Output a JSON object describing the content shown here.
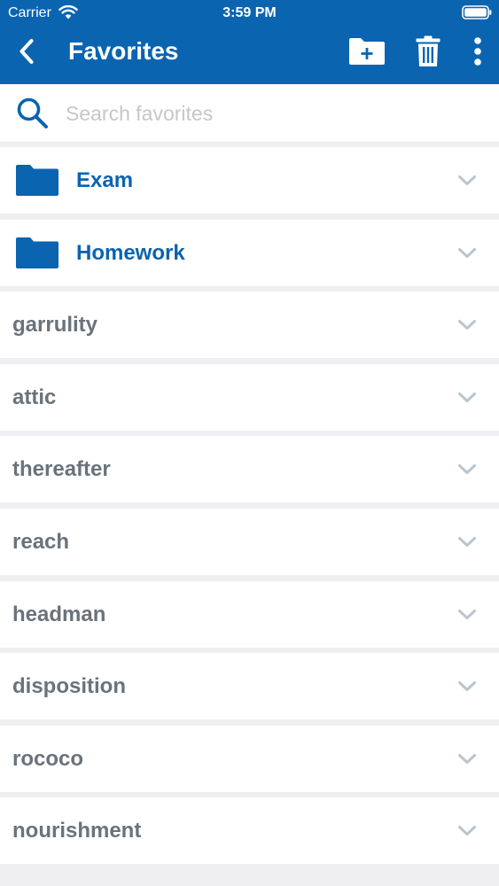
{
  "status_bar": {
    "carrier": "Carrier",
    "time": "3:59 PM",
    "icons": [
      "wifi-icon",
      "battery-icon"
    ]
  },
  "nav": {
    "title": "Favorites",
    "back_icon": "chevron-left-icon",
    "actions": [
      "new-folder-icon",
      "trash-icon",
      "more-vertical-icon"
    ]
  },
  "search": {
    "placeholder": "Search favorites",
    "value": "",
    "icon": "search-icon"
  },
  "folders": [
    {
      "label": "Exam",
      "icon": "folder-icon"
    },
    {
      "label": "Homework",
      "icon": "folder-icon"
    }
  ],
  "words": [
    {
      "label": "garrulity"
    },
    {
      "label": "attic"
    },
    {
      "label": "thereafter"
    },
    {
      "label": "reach"
    },
    {
      "label": "headman"
    },
    {
      "label": "disposition"
    },
    {
      "label": "rococo"
    },
    {
      "label": "nourishment"
    }
  ],
  "colors": {
    "header": "#0a64b0",
    "folder_accent": "#0a64b0",
    "word_text": "#6a737b",
    "chevron": "#b9c6d0",
    "background": "#efeff1",
    "search_placeholder": "#c4c7cb"
  }
}
